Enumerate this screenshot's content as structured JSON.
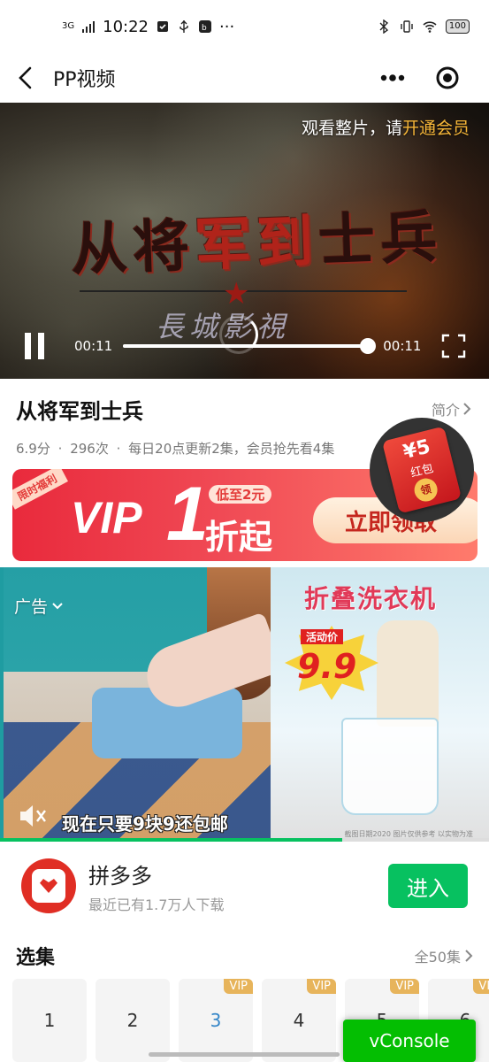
{
  "status_bar": {
    "network": "3G",
    "time": "10:22",
    "more": "···",
    "battery": "100"
  },
  "nav": {
    "title": "PP视频",
    "more_icon": "more-dots-icon",
    "close_icon": "close-target-icon"
  },
  "video": {
    "vip_hint_prefix": "观看整片，请",
    "vip_hint_link": "开通会员",
    "current_time": "00:11",
    "total_time": "00:11",
    "progress": 0.98,
    "overlay_title_a": "从将",
    "overlay_title_b": "军到",
    "overlay_title_c": "士兵",
    "overlay_studio": "長城影視"
  },
  "drama": {
    "title": "从将军到士兵",
    "intro_label": "简介",
    "score": "6.9分",
    "plays": "296次",
    "update": "每日20点更新2集，会员抢先看4集"
  },
  "red_packet": {
    "amount": "¥5",
    "label": "红包",
    "button": "领"
  },
  "vip_banner": {
    "tag": "限时福利",
    "vip": "VIP",
    "one": "1",
    "low": "低至2元",
    "discount": "折起",
    "button": "立即领取"
  },
  "ad": {
    "label": "广告",
    "product_title": "折叠洗衣机",
    "price_label": "活动价",
    "price": "9.9",
    "caption": "现在只要9块9还包邮",
    "fine_print": "截图日期2020 图片仅供参考 以实物为准",
    "progress": 0.7
  },
  "app": {
    "name": "拼多多",
    "subtitle": "最近已有1.7万人下载",
    "enter_label": "进入"
  },
  "episodes": {
    "title": "选集",
    "all_label": "全50集",
    "items": [
      {
        "num": "1",
        "vip": false,
        "active": false
      },
      {
        "num": "2",
        "vip": false,
        "active": false
      },
      {
        "num": "3",
        "vip": true,
        "active": true
      },
      {
        "num": "4",
        "vip": true,
        "active": false
      },
      {
        "num": "5",
        "vip": true,
        "active": false
      },
      {
        "num": "6",
        "vip": true,
        "active": false
      }
    ],
    "vip_badge": "VIP"
  },
  "vconsole": {
    "label": "vConsole"
  },
  "colors": {
    "accent_green": "#07c160",
    "vip_gold": "#e7b45b",
    "vip_link": "#f6b638",
    "active_episode": "#3486c8",
    "banner_red": "#e92a3c"
  }
}
